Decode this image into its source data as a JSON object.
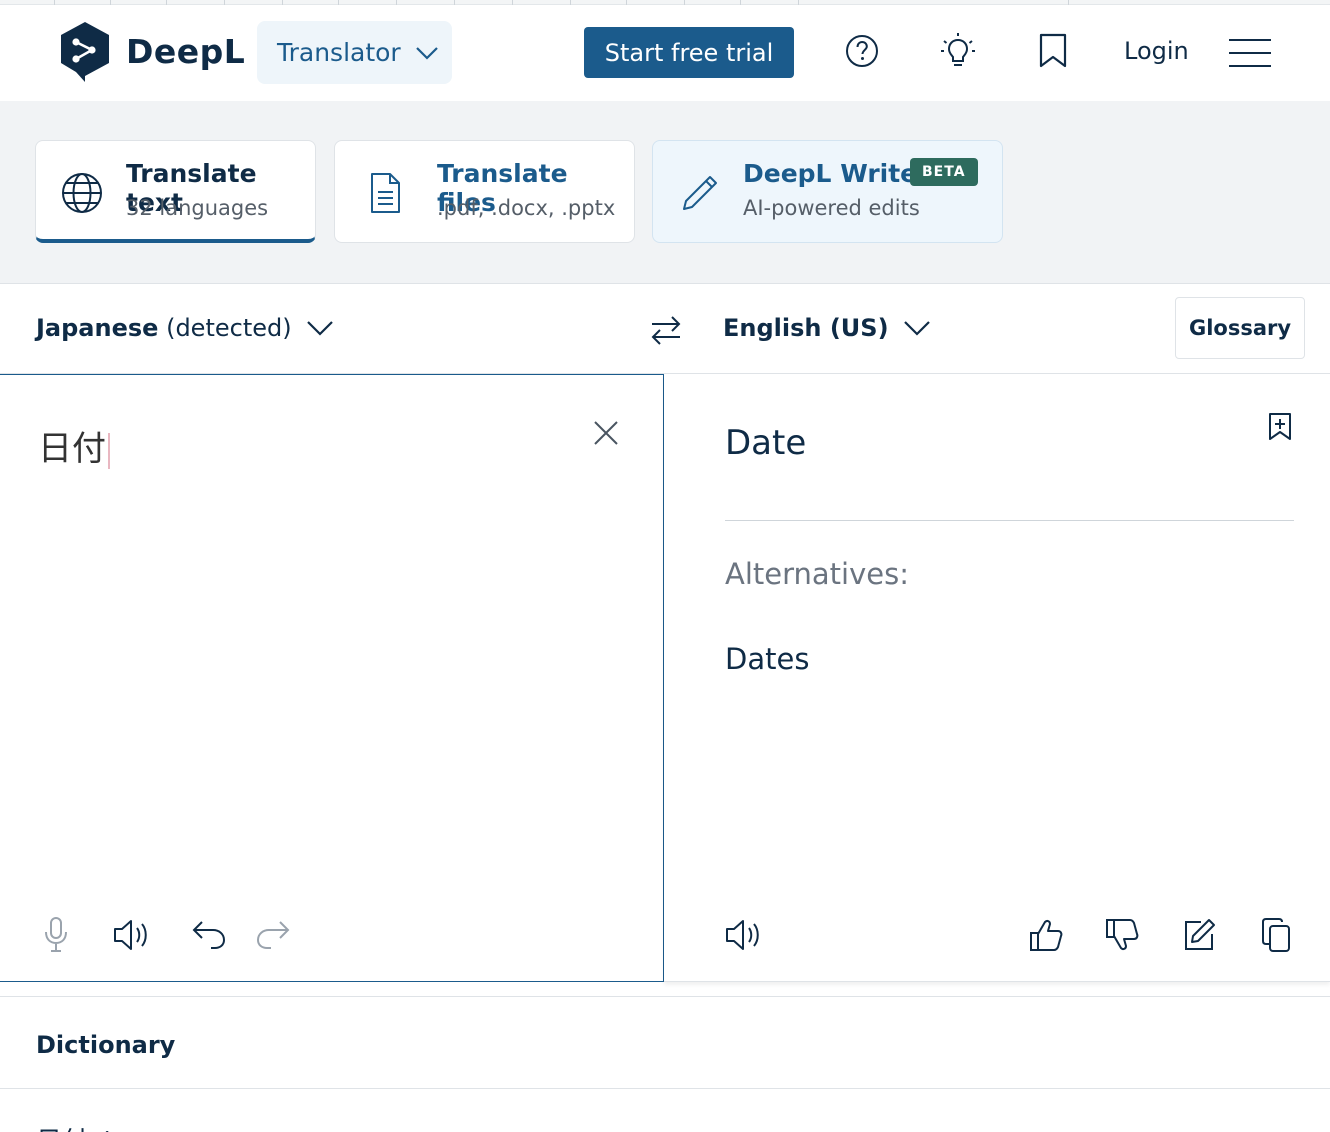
{
  "header": {
    "brand": "DeepL",
    "translator_label": "Translator",
    "trial_label": "Start free trial",
    "login_label": "Login",
    "brand_color": "#0f2b46",
    "accent_color": "#1b5b8c"
  },
  "tools": [
    {
      "title": "Translate text",
      "subtitle": "32 languages",
      "icon": "globe-icon"
    },
    {
      "title": "Translate files",
      "subtitle": ".pdf, .docx, .pptx",
      "icon": "document-icon"
    },
    {
      "title": "DeepL Write",
      "subtitle": "AI-powered edits",
      "badge": "BETA",
      "icon": "pencil-icon"
    }
  ],
  "languages": {
    "source_name": "Japanese",
    "source_suffix": "(detected)",
    "target_name": "English (US)",
    "glossary_label": "Glossary"
  },
  "source": {
    "text": "日付"
  },
  "target": {
    "text": "Date",
    "alternatives_label": "Alternatives:",
    "alternatives": [
      "Dates"
    ]
  },
  "dictionary": {
    "title": "Dictionary",
    "entry": "日付 ⌃"
  }
}
